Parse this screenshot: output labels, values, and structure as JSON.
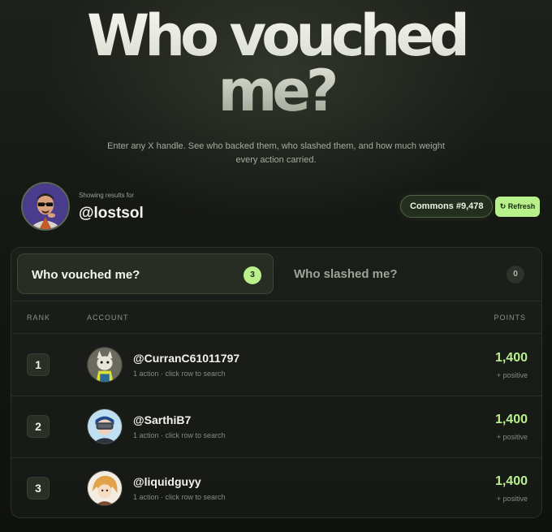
{
  "hero": {
    "title_line1": "Who vouched",
    "title_line2": "me?",
    "subtitle": "Enter any X handle. See who backed them, who slashed them, and how much weight every action carried."
  },
  "profile": {
    "showing_label": "Showing results for",
    "handle": "@lostsol",
    "commons_badge": "Commons #9,478",
    "refresh_label": "↻ Refresh"
  },
  "tabs": [
    {
      "label": "Who vouched me?",
      "count": "3",
      "active": true
    },
    {
      "label": "Who slashed me?",
      "count": "0",
      "active": false
    }
  ],
  "table": {
    "headers": {
      "rank": "RANK",
      "account": "ACCOUNT",
      "points": "POINTS"
    },
    "rows": [
      {
        "rank": "1",
        "handle": "@CurranC61011797",
        "sub": "1 action · click row to search",
        "points": "1,400",
        "points_sub": "+ positive",
        "avatar": "cat-character-avatar"
      },
      {
        "rank": "2",
        "handle": "@SarthiB7",
        "sub": "1 action · click row to search",
        "points": "1,400",
        "points_sub": "+ positive",
        "avatar": "vr-headset-avatar"
      },
      {
        "rank": "3",
        "handle": "@liquidguyy",
        "sub": "1 action · click row to search",
        "points": "1,400",
        "points_sub": "+ positive",
        "avatar": "anime-character-avatar"
      }
    ]
  },
  "colors": {
    "accent": "#b8f08c",
    "background": "#161815",
    "panel_border": "#2c3128"
  }
}
